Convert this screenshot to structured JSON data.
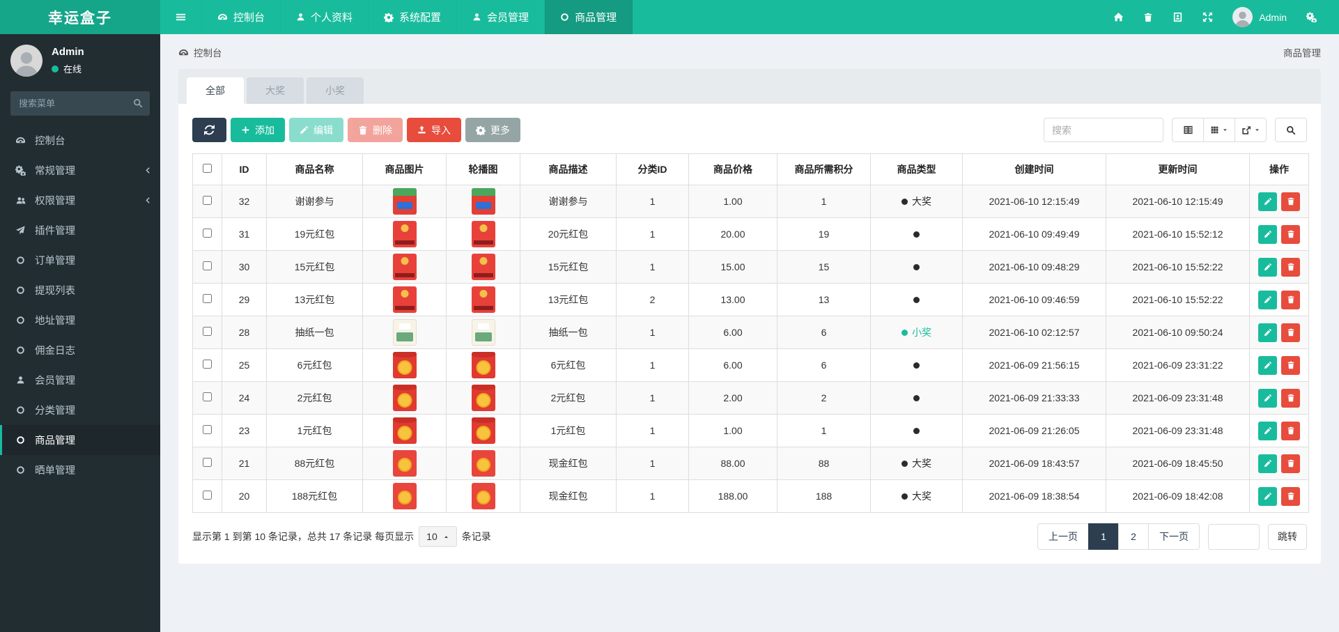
{
  "brand": {
    "name": "幸运盒子"
  },
  "topnav": {
    "menu": [
      {
        "label": "控制台",
        "icon": "dashboard-icon",
        "active": false
      },
      {
        "label": "个人资料",
        "icon": "user-icon",
        "active": false
      },
      {
        "label": "系统配置",
        "icon": "gear-icon",
        "active": false
      },
      {
        "label": "会员管理",
        "icon": "user-icon",
        "active": false
      },
      {
        "label": "商品管理",
        "icon": "circle-icon",
        "active": true
      }
    ],
    "user": "Admin"
  },
  "sidebar": {
    "user": {
      "name": "Admin",
      "status": "在线"
    },
    "search_placeholder": "搜索菜单",
    "items": [
      {
        "label": "控制台",
        "icon": "dashboard-icon",
        "chevron": false,
        "active": false
      },
      {
        "label": "常规管理",
        "icon": "cogs-icon",
        "chevron": true,
        "active": false
      },
      {
        "label": "权限管理",
        "icon": "users-icon",
        "chevron": true,
        "active": false
      },
      {
        "label": "插件管理",
        "icon": "plane-icon",
        "chevron": false,
        "active": false
      },
      {
        "label": "订单管理",
        "icon": "circle-icon",
        "chevron": false,
        "active": false
      },
      {
        "label": "提现列表",
        "icon": "circle-icon",
        "chevron": false,
        "active": false
      },
      {
        "label": "地址管理",
        "icon": "circle-icon",
        "chevron": false,
        "active": false
      },
      {
        "label": "佣金日志",
        "icon": "circle-icon",
        "chevron": false,
        "active": false
      },
      {
        "label": "会员管理",
        "icon": "user-icon",
        "chevron": false,
        "active": false
      },
      {
        "label": "分类管理",
        "icon": "circle-icon",
        "chevron": false,
        "active": false
      },
      {
        "label": "商品管理",
        "icon": "circle-icon",
        "chevron": false,
        "active": true
      },
      {
        "label": "晒单管理",
        "icon": "circle-icon",
        "chevron": false,
        "active": false
      }
    ]
  },
  "breadcrumb": {
    "left": "控制台",
    "right": "商品管理"
  },
  "tabs": [
    {
      "label": "全部",
      "active": true
    },
    {
      "label": "大奖",
      "active": false
    },
    {
      "label": "小奖",
      "active": false
    }
  ],
  "toolbar": {
    "add": "添加",
    "edit": "编辑",
    "delete": "删除",
    "import": "导入",
    "more": "更多",
    "search_placeholder": "搜索"
  },
  "table": {
    "headers": [
      "ID",
      "商品名称",
      "商品图片",
      "轮播图",
      "商品描述",
      "分类ID",
      "商品价格",
      "商品所需积分",
      "商品类型",
      "创建时间",
      "更新时间",
      "操作"
    ],
    "rows": [
      {
        "id": "32",
        "name": "谢谢参与",
        "image": "gift-green-red",
        "desc": "谢谢参与",
        "category_id": "1",
        "price": "1.00",
        "points": "1",
        "type": {
          "label": "大奖",
          "color": "#2b2b2b"
        },
        "created": "2021-06-10 12:15:49",
        "updated": "2021-06-10 12:15:49"
      },
      {
        "id": "31",
        "name": "19元红包",
        "image": "red-envelope-band",
        "desc": "20元红包",
        "category_id": "1",
        "price": "20.00",
        "points": "19",
        "type": {
          "label": "",
          "color": "#2b2b2b"
        },
        "created": "2021-06-10 09:49:49",
        "updated": "2021-06-10 15:52:12"
      },
      {
        "id": "30",
        "name": "15元红包",
        "image": "red-envelope-band",
        "desc": "15元红包",
        "category_id": "1",
        "price": "15.00",
        "points": "15",
        "type": {
          "label": "",
          "color": "#2b2b2b"
        },
        "created": "2021-06-10 09:48:29",
        "updated": "2021-06-10 15:52:22"
      },
      {
        "id": "29",
        "name": "13元红包",
        "image": "red-envelope-band",
        "desc": "13元红包",
        "category_id": "2",
        "price": "13.00",
        "points": "13",
        "type": {
          "label": "",
          "color": "#2b2b2b"
        },
        "created": "2021-06-10 09:46:59",
        "updated": "2021-06-10 15:52:22"
      },
      {
        "id": "28",
        "name": "抽纸一包",
        "image": "tissue-pack",
        "desc": "抽纸一包",
        "category_id": "1",
        "price": "6.00",
        "points": "6",
        "type": {
          "label": "小奖",
          "color": "#18bc9c"
        },
        "created": "2021-06-10 02:12:57",
        "updated": "2021-06-10 09:50:24"
      },
      {
        "id": "25",
        "name": "6元红包",
        "image": "red-envelope-coin",
        "desc": "6元红包",
        "category_id": "1",
        "price": "6.00",
        "points": "6",
        "type": {
          "label": "",
          "color": "#2b2b2b"
        },
        "created": "2021-06-09 21:56:15",
        "updated": "2021-06-09 23:31:22"
      },
      {
        "id": "24",
        "name": "2元红包",
        "image": "red-envelope-coin",
        "desc": "2元红包",
        "category_id": "1",
        "price": "2.00",
        "points": "2",
        "type": {
          "label": "",
          "color": "#2b2b2b"
        },
        "created": "2021-06-09 21:33:33",
        "updated": "2021-06-09 23:31:48"
      },
      {
        "id": "23",
        "name": "1元红包",
        "image": "red-envelope-coin",
        "desc": "1元红包",
        "category_id": "1",
        "price": "1.00",
        "points": "1",
        "type": {
          "label": "",
          "color": "#2b2b2b"
        },
        "created": "2021-06-09 21:26:05",
        "updated": "2021-06-09 23:31:48"
      },
      {
        "id": "21",
        "name": "88元红包",
        "image": "red-envelope-gold",
        "desc": "现金红包",
        "category_id": "1",
        "price": "88.00",
        "points": "88",
        "type": {
          "label": "大奖",
          "color": "#2b2b2b"
        },
        "created": "2021-06-09 18:43:57",
        "updated": "2021-06-09 18:45:50"
      },
      {
        "id": "20",
        "name": "188元红包",
        "image": "red-envelope-gold",
        "desc": "现金红包",
        "category_id": "1",
        "price": "188.00",
        "points": "188",
        "type": {
          "label": "大奖",
          "color": "#2b2b2b"
        },
        "created": "2021-06-09 18:38:54",
        "updated": "2021-06-09 18:42:08"
      }
    ]
  },
  "pagination": {
    "summary_prefix": "显示第 1 到第 10 条记录，总共 17 条记录 每页显示",
    "page_size": "10",
    "summary_suffix": "条记录",
    "prev": "上一页",
    "next": "下一页",
    "pages": [
      "1",
      "2"
    ],
    "active_page": "1",
    "jump": "跳转"
  },
  "colors": {
    "accent": "#18bc9c",
    "navy": "#2c3e50",
    "danger": "#e74c3c",
    "sidebar": "#222d32"
  }
}
